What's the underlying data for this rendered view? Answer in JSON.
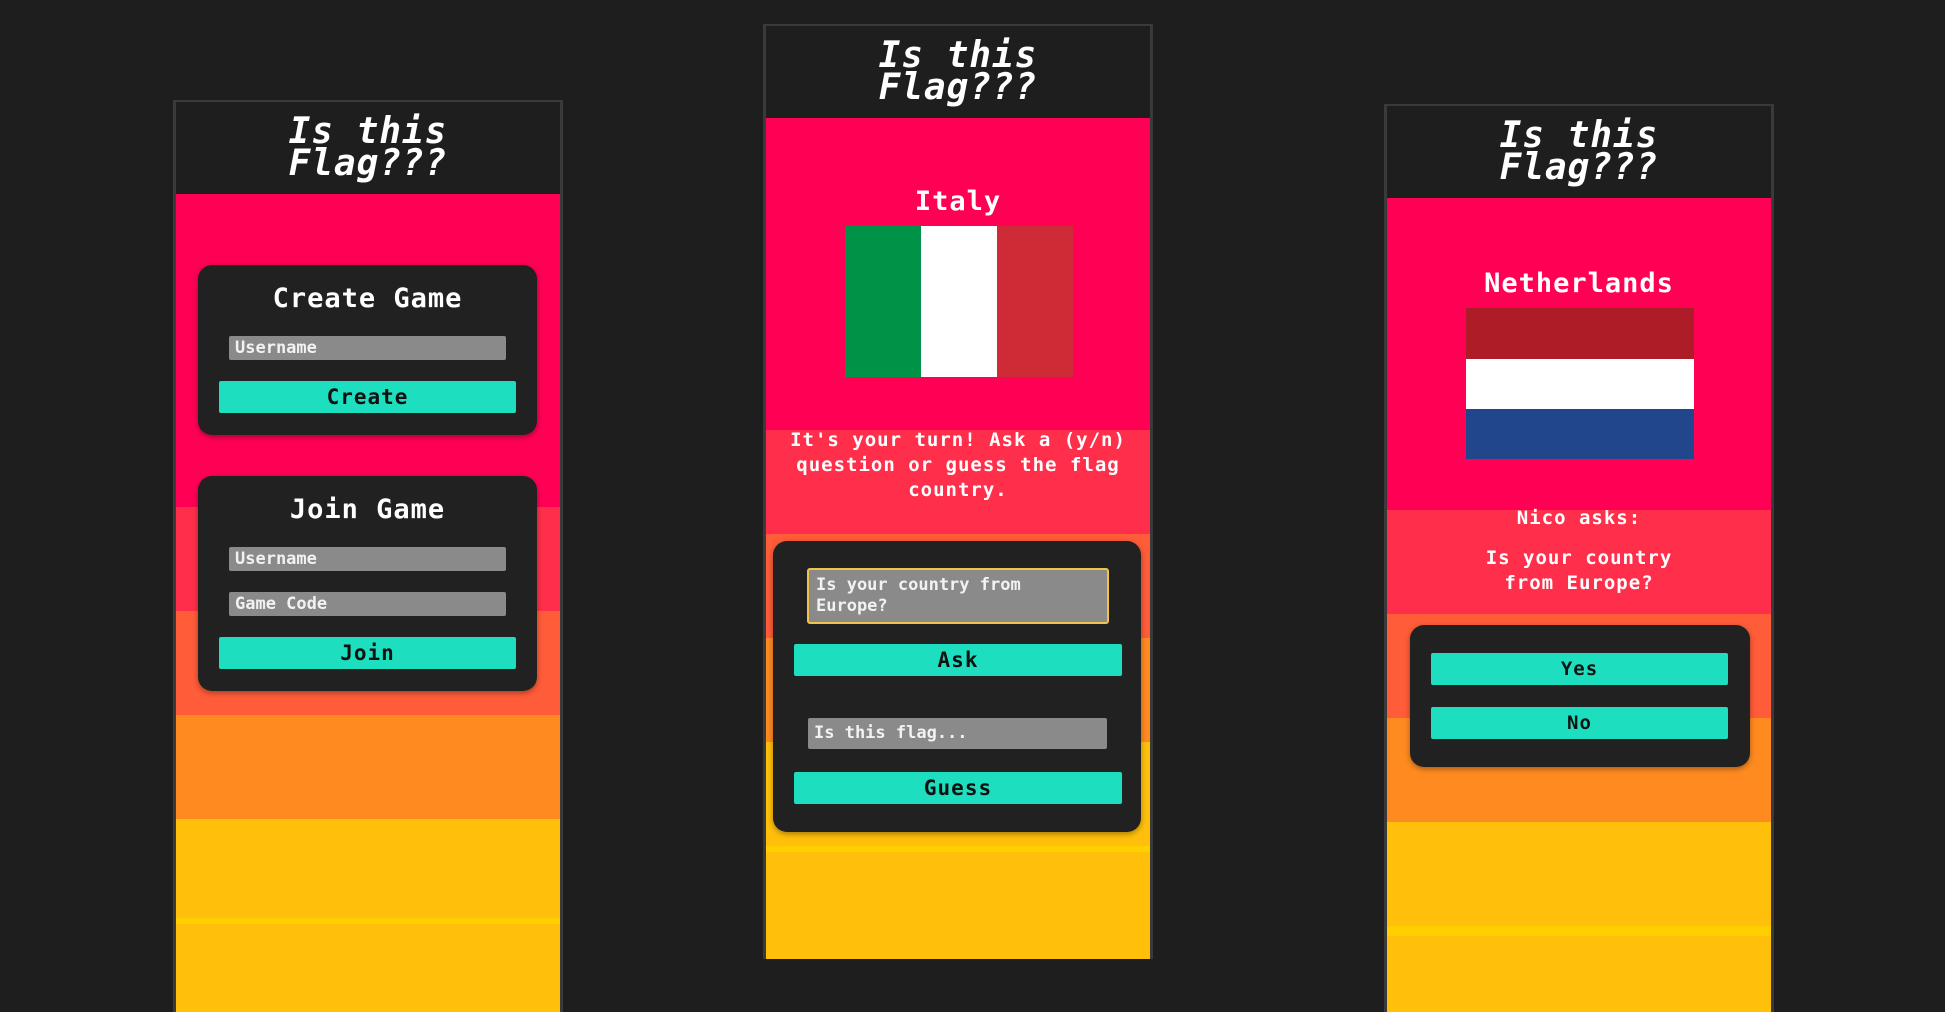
{
  "app_title_line1": "Is this",
  "app_title_line2": "Flag???",
  "colors": {
    "background": "#1e1e1e",
    "band1": "#ff0054",
    "band2": "#ff2f4b",
    "band3": "#ff5c39",
    "band4": "#ff8a20",
    "band5": "#ffbf0b",
    "band_accent": "#ffcf00",
    "button": "#1ddfbf",
    "input": "#8a8a8a",
    "focus_border": "#f0c34a"
  },
  "lobby": {
    "create": {
      "title": "Create Game",
      "username_placeholder": "Username",
      "button_label": "Create"
    },
    "join": {
      "title": "Join Game",
      "username_placeholder": "Username",
      "code_placeholder": "Game Code",
      "button_label": "Join"
    }
  },
  "ask_screen": {
    "country": "Italy",
    "flag_colors": [
      "#009246",
      "#ffffff",
      "#ce2b37"
    ],
    "message": "It's your turn! Ask a (y/n) question or guess the flag country.",
    "question_value": "Is your country from Europe?",
    "ask_label": "Ask",
    "guess_placeholder": "Is this flag...",
    "guess_label": "Guess"
  },
  "answer_screen": {
    "country": "Netherlands",
    "flag_colors": [
      "#ae1c28",
      "#ffffff",
      "#21468b"
    ],
    "asker_line": "Nico asks:",
    "question": "Is your country from Europe?",
    "yes_label": "Yes",
    "no_label": "No"
  }
}
